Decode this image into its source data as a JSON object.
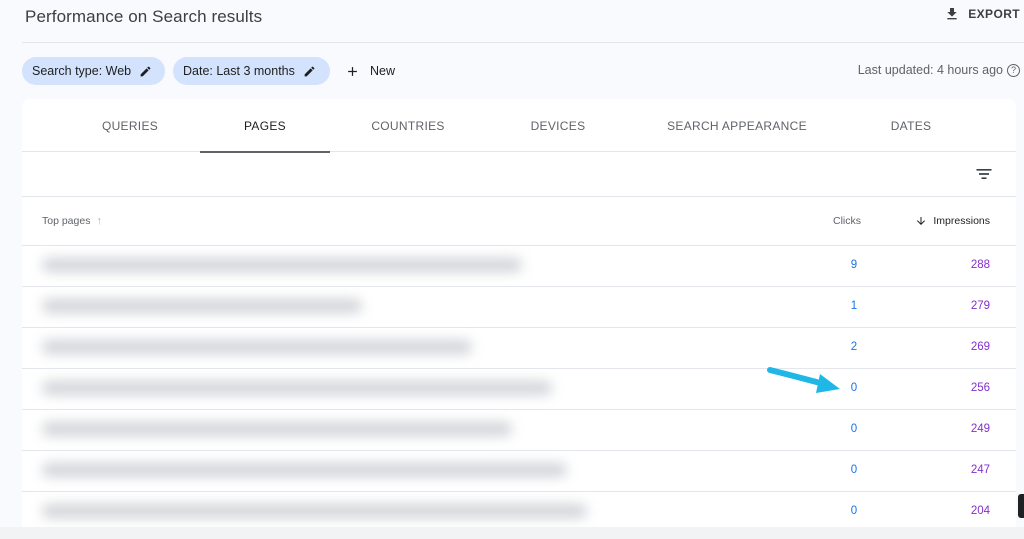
{
  "header": {
    "title": "Performance on Search results",
    "export_label": "EXPORT"
  },
  "filters": {
    "search_type": "Search type: Web",
    "date": "Date: Last 3 months",
    "new_label": "New",
    "last_updated": "Last updated: 4 hours ago"
  },
  "tabs": [
    {
      "label": "QUERIES"
    },
    {
      "label": "PAGES"
    },
    {
      "label": "COUNTRIES"
    },
    {
      "label": "DEVICES"
    },
    {
      "label": "SEARCH APPEARANCE"
    },
    {
      "label": "DATES"
    }
  ],
  "active_tab": "PAGES",
  "table": {
    "col_pages": "Top pages",
    "col_clicks": "Clicks",
    "col_impressions": "Impressions",
    "rows": [
      {
        "clicks": "9",
        "impressions": "288"
      },
      {
        "clicks": "1",
        "impressions": "279"
      },
      {
        "clicks": "2",
        "impressions": "269"
      },
      {
        "clicks": "0",
        "impressions": "256"
      },
      {
        "clicks": "0",
        "impressions": "249"
      },
      {
        "clicks": "0",
        "impressions": "247"
      },
      {
        "clicks": "0",
        "impressions": "204"
      }
    ]
  },
  "colors": {
    "clicks": "#1a73e8",
    "impressions": "#8430ce",
    "chip_bg": "#d3e3fd",
    "annotation_arrow": "#1fb8e6"
  }
}
